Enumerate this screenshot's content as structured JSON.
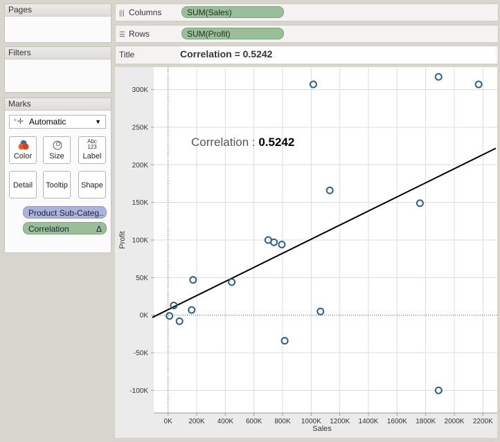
{
  "left_panels": {
    "pages_label": "Pages",
    "filters_label": "Filters",
    "marks_label": "Marks"
  },
  "marks": {
    "mark_type": "Automatic",
    "buttons": {
      "color": "Color",
      "size": "Size",
      "label": "Label",
      "label_icon_text_1": "Abc",
      "label_icon_text_2": "123",
      "detail": "Detail",
      "tooltip": "Tooltip",
      "shape": "Shape"
    },
    "pills": [
      {
        "label": "Product Sub-Categ..",
        "color": "#aab3d9"
      },
      {
        "label": "Correlation",
        "color": "#9bbe9a",
        "delta": "Δ"
      }
    ]
  },
  "shelves": {
    "columns_label": "Columns",
    "columns_pill": "SUM(Sales)",
    "rows_label": "Rows",
    "rows_pill": "SUM(Profit)",
    "title_label": "Title",
    "title_value": "Correlation = 0.5242"
  },
  "colors": {
    "point_stroke": "#2b5f8f",
    "trend_line": "#000000",
    "grid": "#dcdcdc"
  },
  "chart_data": {
    "type": "scatter",
    "xlabel": "Sales",
    "ylabel": "Profit",
    "xlim": [
      -100000,
      2300000
    ],
    "ylim": [
      -130000,
      330000
    ],
    "x_ticks": [
      0,
      200000,
      400000,
      600000,
      800000,
      1000000,
      1200000,
      1400000,
      1600000,
      1800000,
      2000000,
      2200000
    ],
    "x_tick_labels": [
      "0K",
      "200K",
      "400K",
      "600K",
      "800K",
      "1000K",
      "1200K",
      "1400K",
      "1600K",
      "1800K",
      "2000K",
      "2200K"
    ],
    "y_ticks": [
      -100000,
      -50000,
      0,
      50000,
      100000,
      150000,
      200000,
      250000,
      300000
    ],
    "y_tick_labels": [
      "-100K",
      "-50K",
      "0K",
      "50K",
      "100K",
      "150K",
      "200K",
      "250K",
      "300K"
    ],
    "points": [
      {
        "x": 10000,
        "y": -1000
      },
      {
        "x": 40000,
        "y": 13000
      },
      {
        "x": 80000,
        "y": -8000
      },
      {
        "x": 165000,
        "y": 7000
      },
      {
        "x": 175000,
        "y": 47000
      },
      {
        "x": 445000,
        "y": 44000
      },
      {
        "x": 700000,
        "y": 100000
      },
      {
        "x": 740000,
        "y": 97000
      },
      {
        "x": 795000,
        "y": 94000
      },
      {
        "x": 815000,
        "y": -34000
      },
      {
        "x": 1015000,
        "y": 307000
      },
      {
        "x": 1065000,
        "y": 5000
      },
      {
        "x": 1130000,
        "y": 166000
      },
      {
        "x": 1760000,
        "y": 149000
      },
      {
        "x": 1890000,
        "y": 317000
      },
      {
        "x": 1890000,
        "y": -100000
      },
      {
        "x": 2170000,
        "y": 307000
      }
    ],
    "trend_line": [
      {
        "x": -110000,
        "y": -3000
      },
      {
        "x": 2290000,
        "y": 222000
      }
    ],
    "annotation": {
      "prefix": "Correlation",
      "separator": " : ",
      "value": "0.5242"
    }
  }
}
